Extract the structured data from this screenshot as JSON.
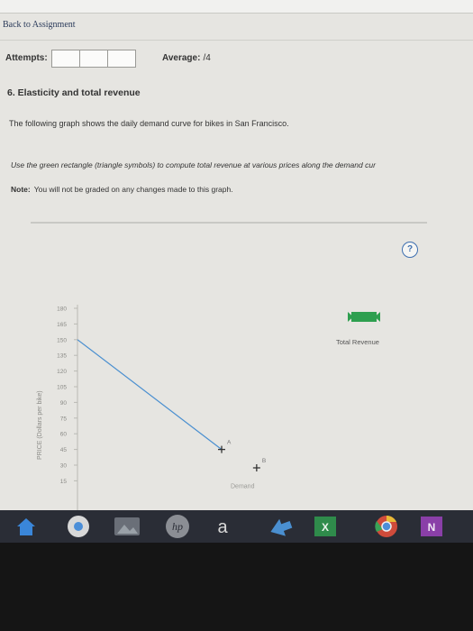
{
  "nav": {
    "back_link": "Back to Assignment"
  },
  "attempts": {
    "label": "Attempts:",
    "boxes": 3
  },
  "average": {
    "label": "Average:",
    "value": "/4"
  },
  "question": {
    "title": "6. Elasticity and total revenue",
    "intro": "The following graph shows the daily demand curve for bikes in San Francisco.",
    "instruction": "Use the green rectangle (triangle symbols) to compute total revenue at various prices along the demand cur",
    "note_label": "Note:",
    "note": "You will not be graded on any changes made to this graph."
  },
  "help": {
    "label": "?"
  },
  "chart_data": {
    "type": "line",
    "ylabel": "PRICE (Dollars per bike)",
    "y_ticks": [
      "180",
      "165",
      "150",
      "135",
      "120",
      "105",
      "90",
      "75",
      "60",
      "45",
      "30",
      "15"
    ],
    "series": [
      {
        "name": "Demand",
        "points": [
          [
            0,
            150
          ],
          [
            1,
            45
          ]
        ]
      }
    ],
    "points": [
      {
        "label": "A",
        "price": 45
      },
      {
        "label": "B",
        "price": 30
      }
    ],
    "legend": {
      "label": "Total Revenue",
      "color": "#2e9f4f"
    },
    "demand_color": "#4a8fd0"
  },
  "taskbar": {
    "icons": [
      "home-icon",
      "chrome-icon",
      "photos-icon",
      "hp-icon",
      "amazon-icon",
      "arrow-icon",
      "excel-icon",
      "chrome-icon-2",
      "onenote-icon"
    ],
    "amazon_glyph": "a",
    "hp_glyph": "hp",
    "excel_glyph": "X",
    "onenote_glyph": "N"
  }
}
